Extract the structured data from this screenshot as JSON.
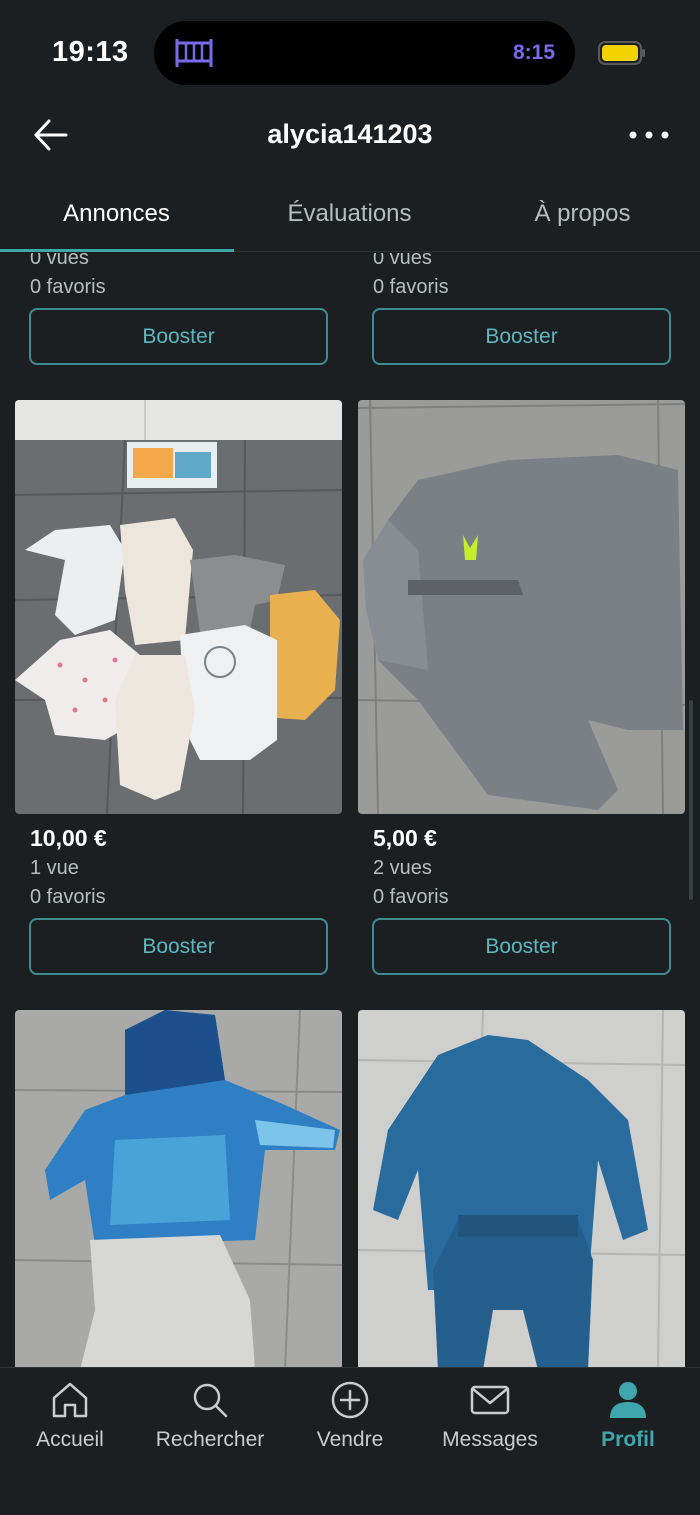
{
  "status_bar": {
    "time": "19:13",
    "timer": "8:15"
  },
  "header": {
    "title": "alycia141203"
  },
  "tabs": [
    {
      "label": "Annonces",
      "active": true
    },
    {
      "label": "Évaluations",
      "active": false
    },
    {
      "label": "À propos",
      "active": false
    }
  ],
  "listings_top": [
    {
      "views": "0 vues",
      "favorites": "0 favoris",
      "boost_label": "Booster"
    },
    {
      "views": "0 vues",
      "favorites": "0 favoris",
      "boost_label": "Booster"
    }
  ],
  "listings": [
    {
      "photo_icon": "baby-bodysuits-photo",
      "price": "10,00 €",
      "views": "1 vue",
      "favorites": "0 favoris",
      "boost_label": "Booster"
    },
    {
      "photo_icon": "grey-sweater-photo",
      "price": "5,00 €",
      "views": "2 vues",
      "favorites": "0 favoris",
      "boost_label": "Booster"
    },
    {
      "photo_icon": "blue-hoodie-set-photo"
    },
    {
      "photo_icon": "blue-outfit-photo"
    }
  ],
  "bottom_nav": [
    {
      "label": "Accueil",
      "icon": "home-icon",
      "active": false
    },
    {
      "label": "Rechercher",
      "icon": "search-icon",
      "active": false
    },
    {
      "label": "Vendre",
      "icon": "plus-circle-icon",
      "active": false
    },
    {
      "label": "Messages",
      "icon": "envelope-icon",
      "active": false
    },
    {
      "label": "Profil",
      "icon": "person-icon",
      "active": true
    }
  ],
  "colors": {
    "accent": "#3fa6ad",
    "background": "#1c1f21",
    "battery": "#f2d200",
    "timer": "#7a6ae8"
  }
}
